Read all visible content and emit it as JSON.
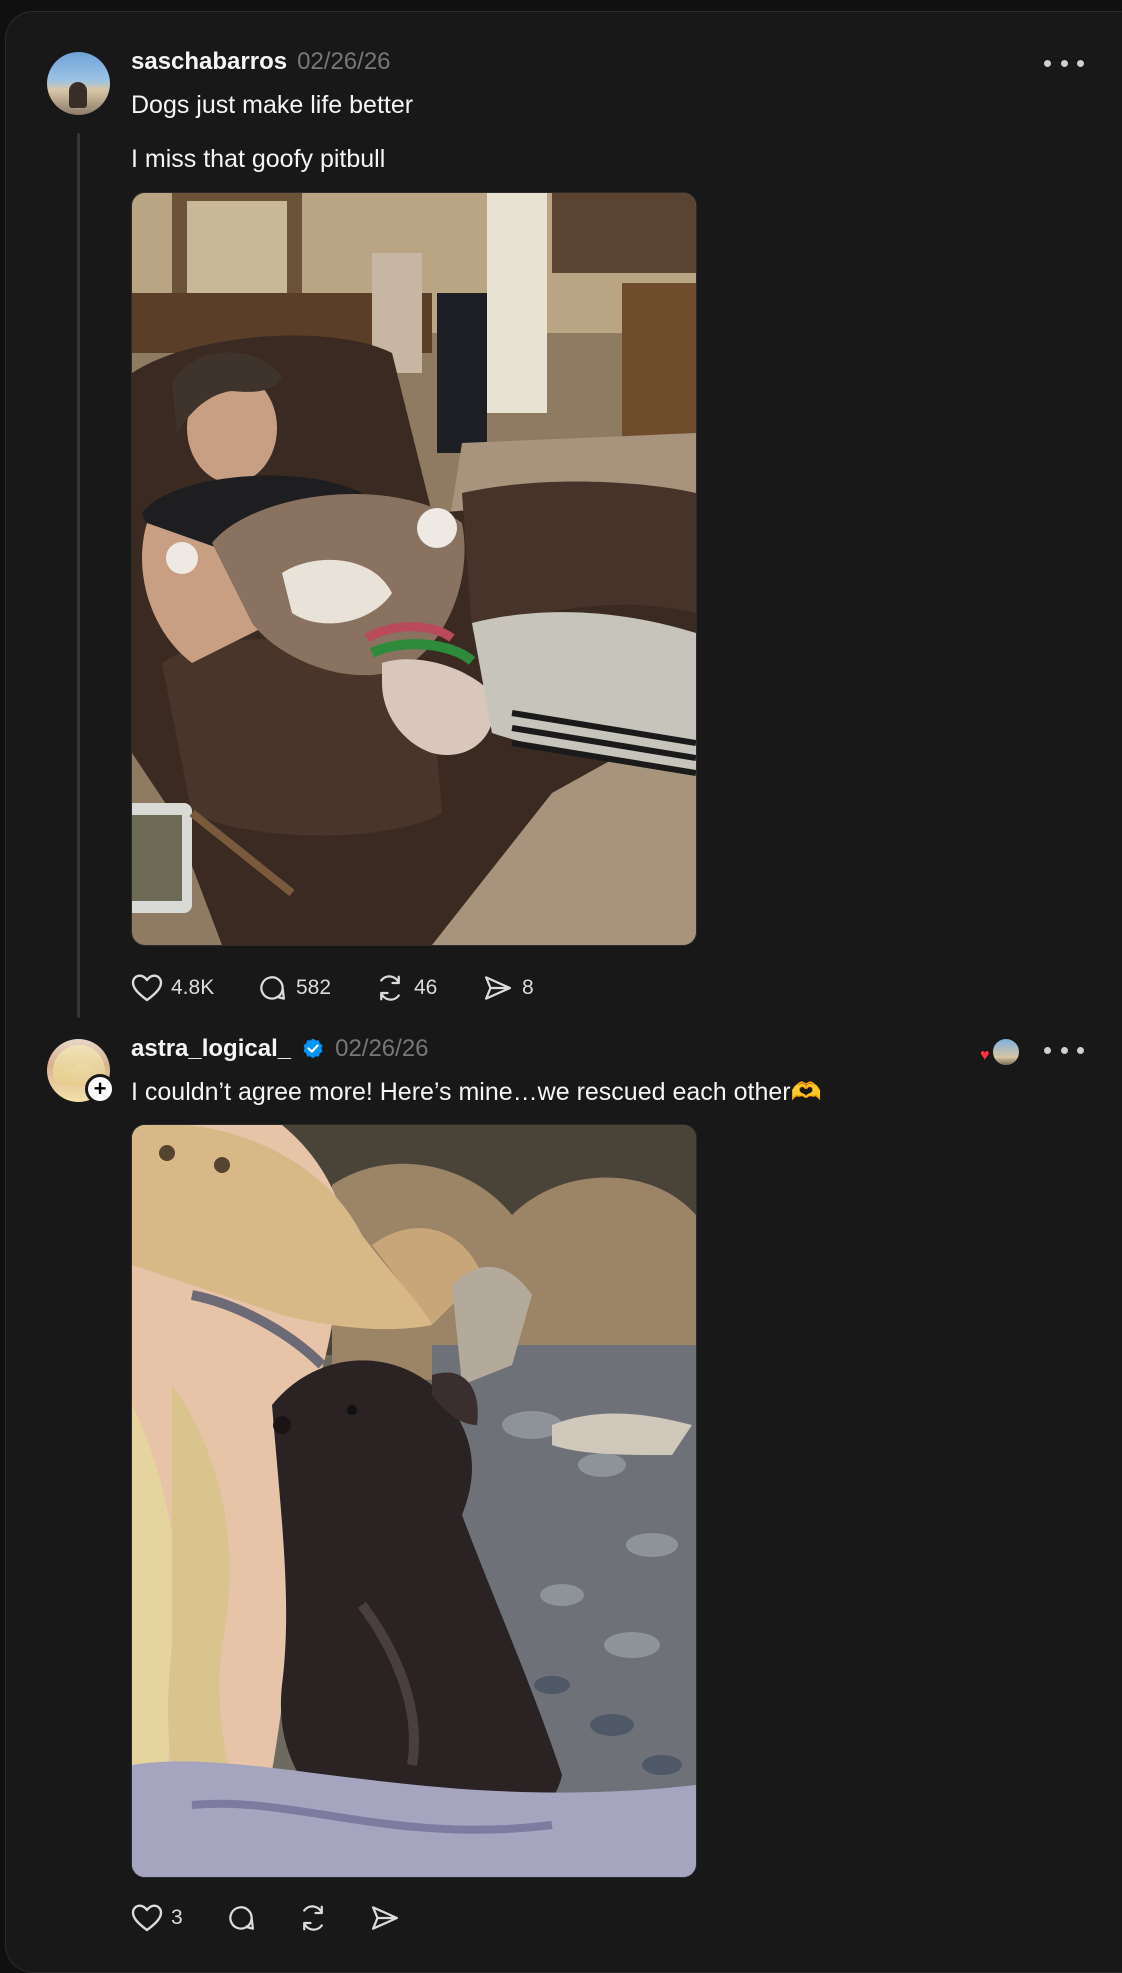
{
  "posts": [
    {
      "username": "saschabarros",
      "date": "02/26/26",
      "verified": false,
      "lines": [
        "Dogs just make life better",
        "I miss that goofy pitbull"
      ],
      "stats": {
        "likes": "4.8K",
        "replies": "582",
        "reposts": "46",
        "shares": "8"
      }
    },
    {
      "username": "astra_logical_",
      "date": "02/26/26",
      "verified": true,
      "lines": [
        "I couldn’t agree more! Here’s mine…we rescued each other🫶"
      ],
      "stats": {
        "likes": "3",
        "replies": "",
        "reposts": "",
        "shares": ""
      }
    }
  ],
  "icons": {
    "more": "more-horizontal-icon",
    "like": "heart-icon",
    "reply": "comment-icon",
    "repost": "repost-icon",
    "share": "send-icon",
    "verified": "verified-badge-icon",
    "follow": "plus-icon"
  },
  "colors": {
    "background": "#101010",
    "card": "#181818",
    "text": "#f3f5f7",
    "muted": "#777777",
    "verified": "#0095f6",
    "heart": "#ff3040"
  }
}
